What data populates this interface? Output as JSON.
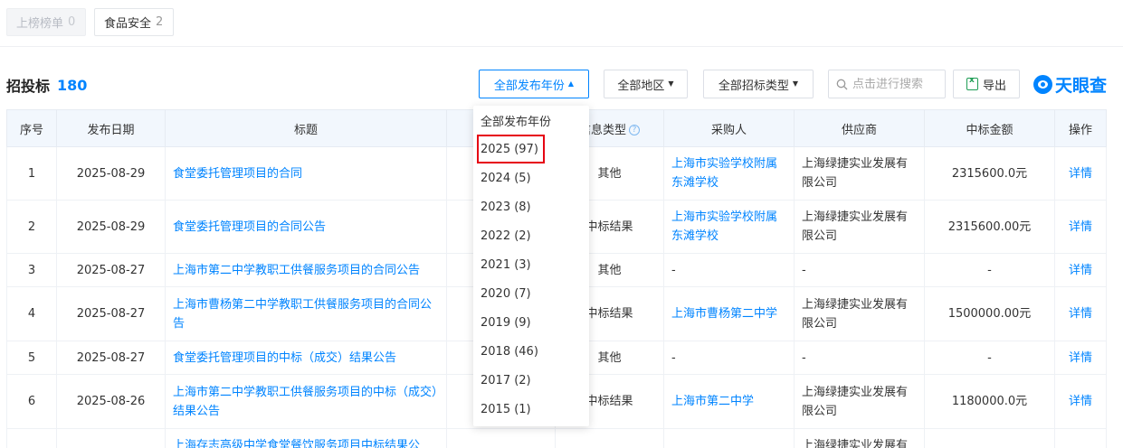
{
  "tabs": [
    {
      "label": "上榜榜单",
      "count": "0"
    },
    {
      "label": "食品安全",
      "count": "2"
    }
  ],
  "section": {
    "title": "招投标",
    "count": "180"
  },
  "filters": {
    "year_label": "全部发布年份",
    "region_label": "全部地区",
    "type_label": "全部招标类型",
    "search_placeholder": "点击进行搜索",
    "export_label": "导出"
  },
  "logo_text": "天眼查",
  "table": {
    "headers": [
      "序号",
      "发布日期",
      "标题",
      "",
      "信息类型",
      "采购人",
      "供应商",
      "中标金额",
      "操作"
    ],
    "rows": [
      {
        "idx": "1",
        "date": "2025-08-29",
        "title": "食堂委托管理项目的合同",
        "type": "其他",
        "buyer": "上海市实验学校附属东滩学校",
        "supplier": "上海绿捷实业发展有限公司",
        "amount": "2315600.0元",
        "action": "详情"
      },
      {
        "idx": "2",
        "date": "2025-08-29",
        "title": "食堂委托管理项目的合同公告",
        "type": "中标结果",
        "buyer": "上海市实验学校附属东滩学校",
        "supplier": "上海绿捷实业发展有限公司",
        "amount": "2315600.00元",
        "action": "详情"
      },
      {
        "idx": "3",
        "date": "2025-08-27",
        "title": "上海市第二中学教职工供餐服务项目的合同公告",
        "type": "其他",
        "buyer": "-",
        "supplier": "-",
        "amount": "-",
        "action": "详情"
      },
      {
        "idx": "4",
        "date": "2025-08-27",
        "title": "上海市曹杨第二中学教职工供餐服务项目的合同公告",
        "type": "中标结果",
        "buyer": "上海市曹杨第二中学",
        "supplier": "上海绿捷实业发展有限公司",
        "amount": "1500000.00元",
        "action": "详情"
      },
      {
        "idx": "5",
        "date": "2025-08-27",
        "title": "食堂委托管理项目的中标（成交）结果公告",
        "type": "其他",
        "buyer": "-",
        "supplier": "-",
        "amount": "-",
        "action": "详情"
      },
      {
        "idx": "6",
        "date": "2025-08-26",
        "title": "上海市第二中学教职工供餐服务项目的中标（成交）结果公告",
        "type": "中标结果",
        "buyer": "上海市第二中学",
        "supplier": "上海绿捷实业发展有限公司",
        "amount": "1180000.0元",
        "action": "详情"
      },
      {
        "idx": "",
        "date": "",
        "title": "上海存志高级中学食堂餐饮服务项目中标结果公",
        "type": "",
        "buyer": "",
        "supplier": "上海绿捷实业发展有",
        "amount": "",
        "action": ""
      }
    ]
  },
  "year_dropdown": {
    "items": [
      "全部发布年份",
      "2025 (97)",
      "2024 (5)",
      "2023 (8)",
      "2022 (2)",
      "2021 (3)",
      "2020 (7)",
      "2019 (9)",
      "2018 (46)",
      "2017 (2)",
      "2015 (1)"
    ],
    "highlight_color": "#e60012"
  },
  "colors": {
    "accent": "#0084ff",
    "header_bg": "#f2f7fd"
  }
}
